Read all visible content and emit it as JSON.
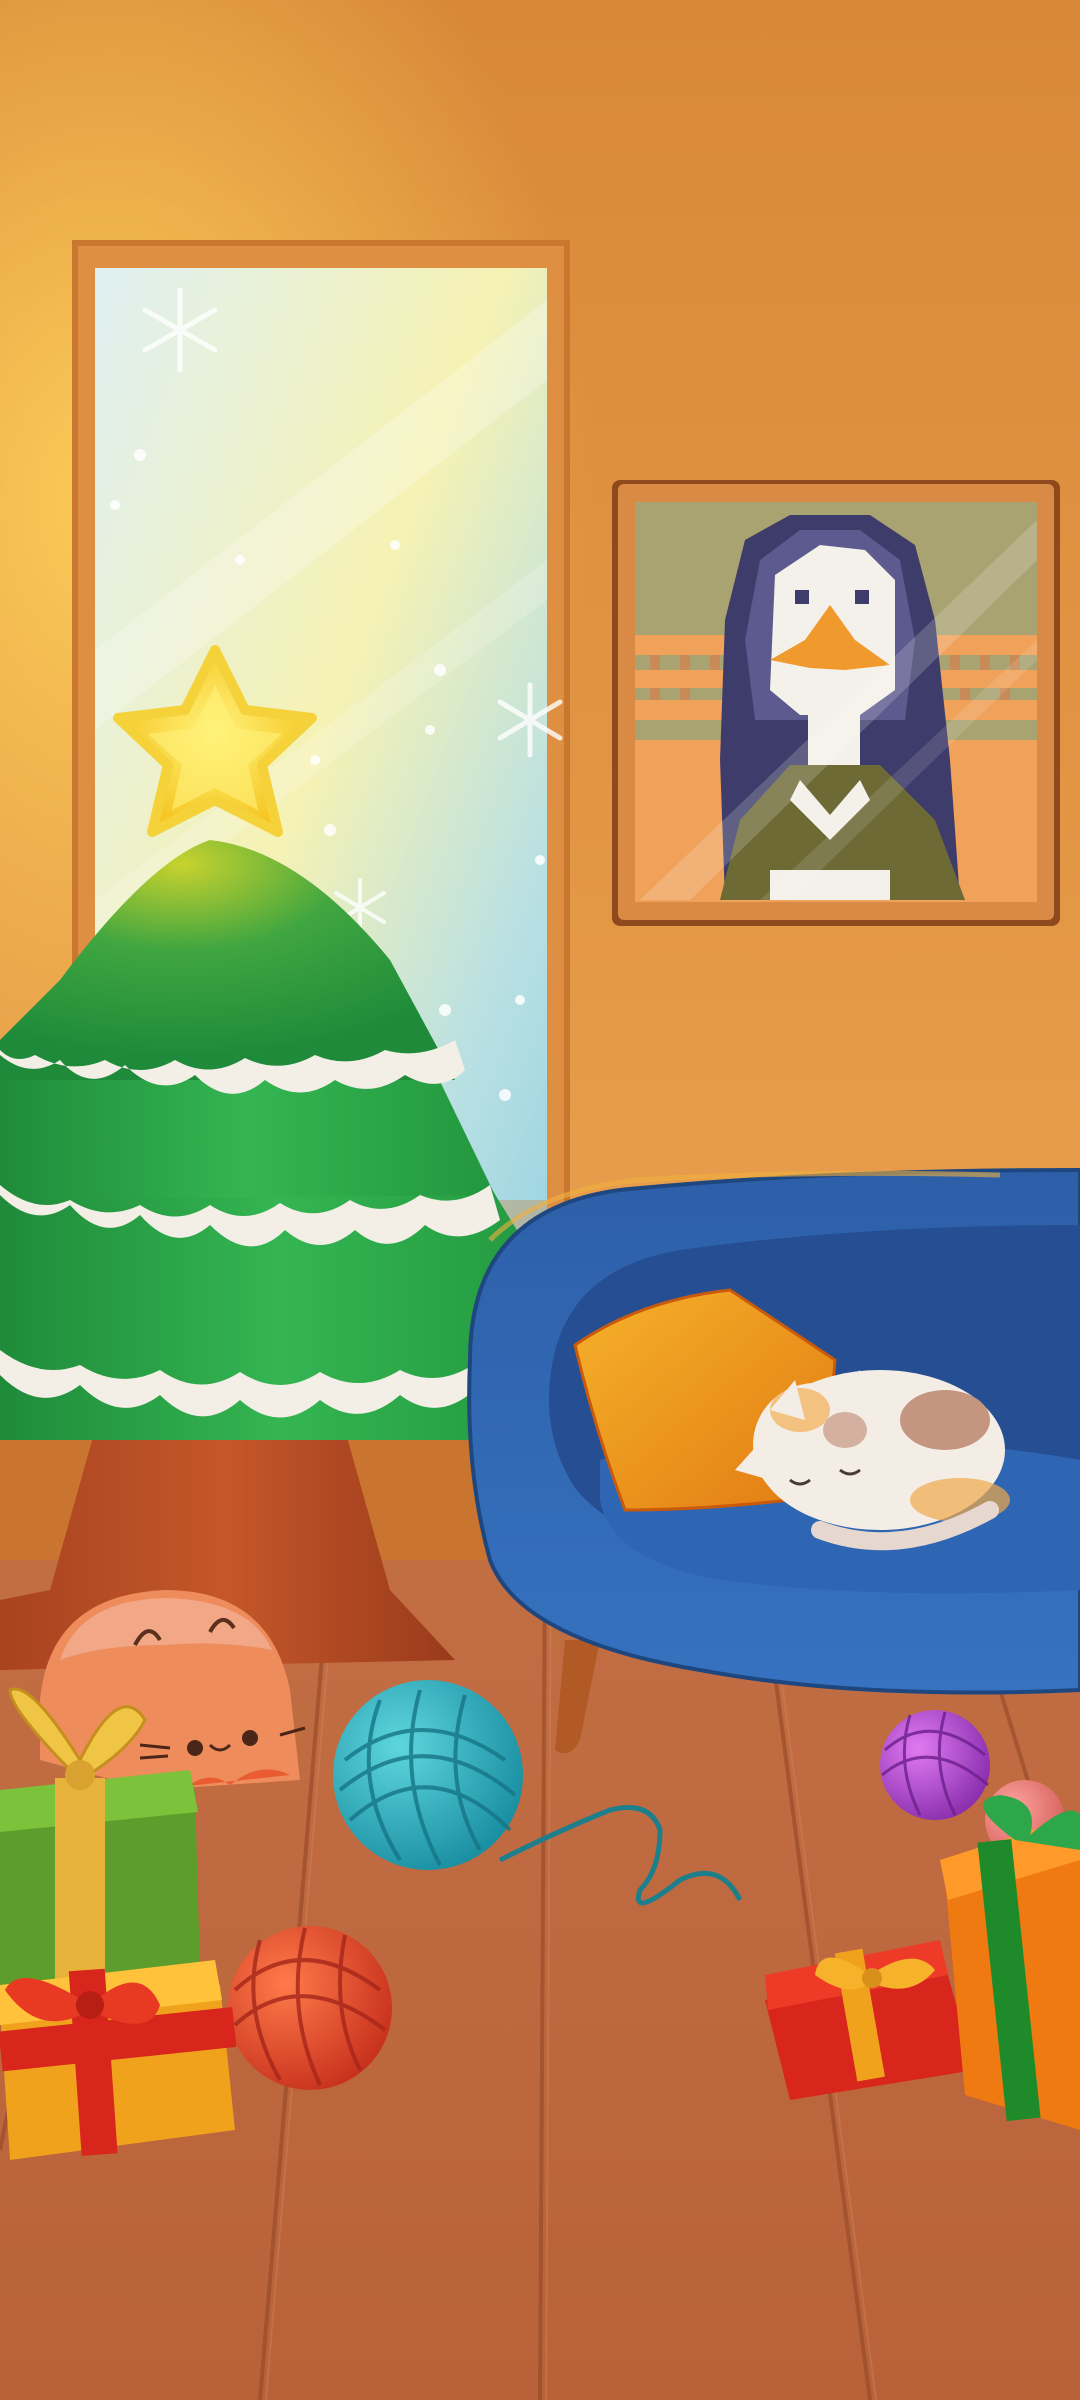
{
  "scene": {
    "name": "cozy-knit-room",
    "palette": {
      "wall_top": "#d9893a",
      "wall_bottom": "#e9a14c",
      "wood_floor": "#c06b3f",
      "tree_green": "#2ea64a",
      "couch_blue": "#2f64b0",
      "star_yellow": "#ffd93a",
      "yarn_teal": "#23a8b8",
      "yarn_red": "#e24a2a",
      "yarn_purple": "#b54ad8",
      "gift_red": "#d9261c",
      "gift_green": "#5d9d2b",
      "gift_orange": "#f0a21c"
    },
    "icons": [
      "window",
      "snowflake-icon",
      "christmas-tree",
      "star-topper-icon",
      "framed-cross-stitch-picture",
      "couch",
      "pillow",
      "sleeping-cat",
      "peeking-cat",
      "yarn-ball-icon",
      "gift-box-icon"
    ]
  }
}
